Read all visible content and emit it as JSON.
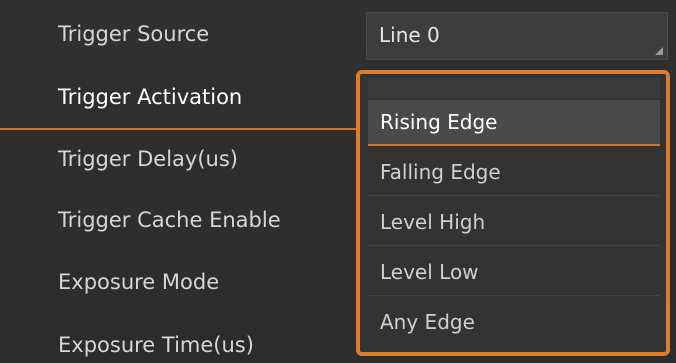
{
  "properties": {
    "rows": [
      {
        "label": "Trigger Source"
      },
      {
        "label": "Trigger Activation"
      },
      {
        "label": "Trigger Delay(us)"
      },
      {
        "label": "Trigger Cache Enable"
      },
      {
        "label": "Exposure Mode"
      },
      {
        "label": "Exposure Time(us)"
      }
    ],
    "trigger_source_value": "Line 0"
  },
  "dropdown": {
    "options": [
      {
        "label": "Rising Edge"
      },
      {
        "label": "Falling Edge"
      },
      {
        "label": "Level High"
      },
      {
        "label": "Level Low"
      },
      {
        "label": "Any Edge"
      }
    ],
    "selected": "Rising Edge"
  },
  "colors": {
    "accent": "#e07b2a",
    "background": "#2f2f2f"
  }
}
